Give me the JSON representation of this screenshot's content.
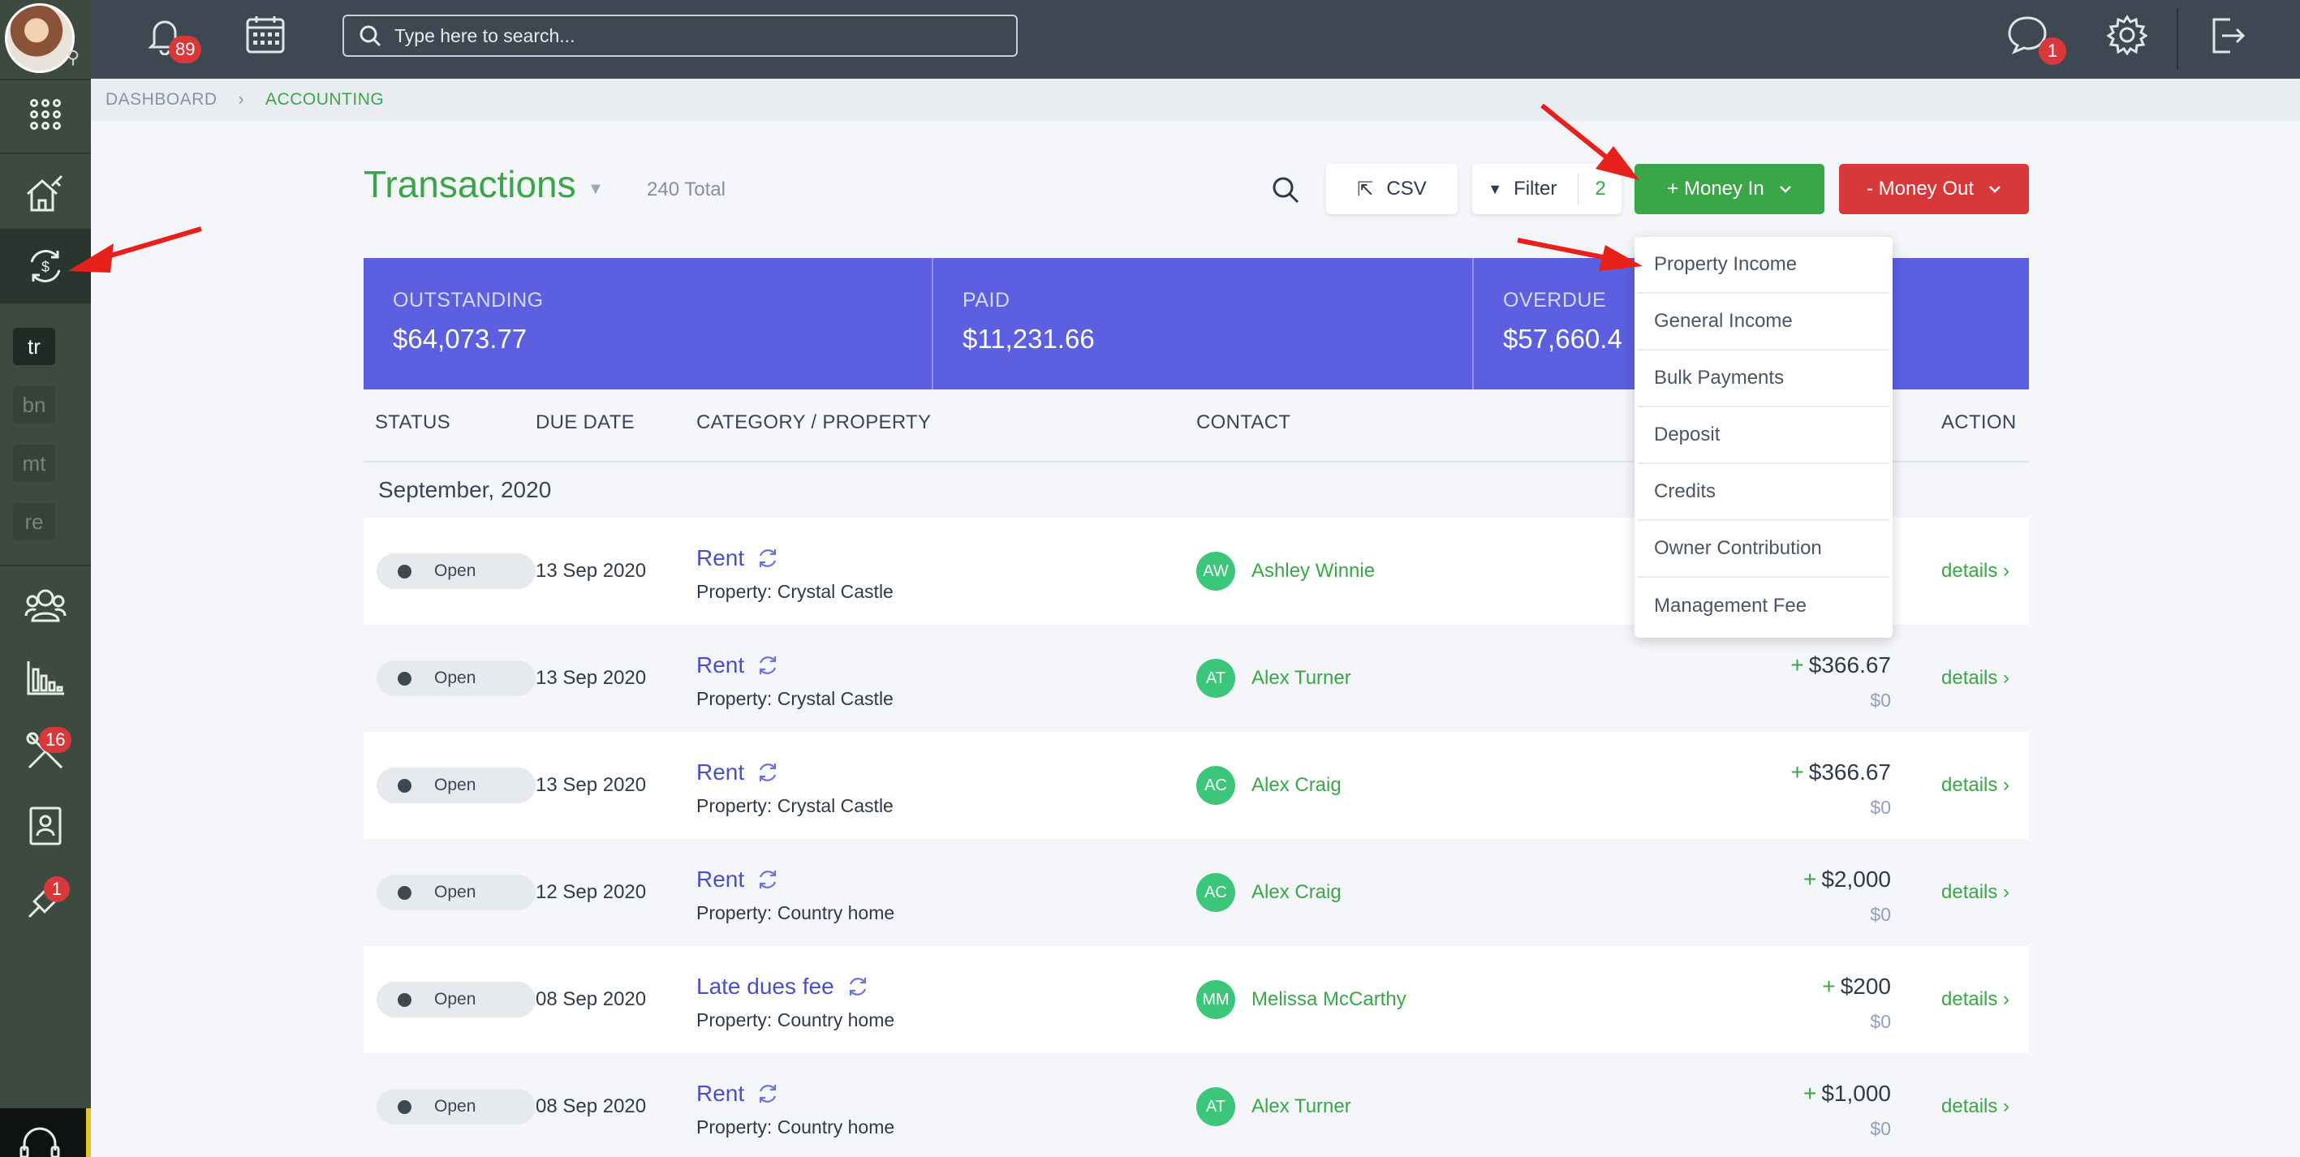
{
  "topbar": {
    "notifications_count": "89",
    "search_placeholder": "Type here to search...",
    "messages_count": "1"
  },
  "sidebar": {
    "chips": [
      "tr",
      "bn",
      "mt",
      "re"
    ],
    "tools_badge": "16",
    "links_badge": "1"
  },
  "breadcrumb": {
    "home": "DASHBOARD",
    "current": "ACCOUNTING"
  },
  "header": {
    "title": "Transactions",
    "total": "240 Total",
    "csv_label": "CSV",
    "filter_label": "Filter",
    "filter_count": "2",
    "money_in_label": "+ Money In",
    "money_out_label": "- Money Out"
  },
  "summary": {
    "outstanding_label": "OUTSTANDING",
    "outstanding_value": "$64,073.77",
    "paid_label": "PAID",
    "paid_value": "$11,231.66",
    "overdue_label": "OVERDUE",
    "overdue_value": "$57,660.4"
  },
  "table": {
    "headers": [
      "STATUS",
      "DUE DATE",
      "CATEGORY / PROPERTY",
      "CONTACT",
      "ACTION"
    ],
    "month": "September, 2020",
    "details_label": "details",
    "rows": [
      {
        "status": "Open",
        "date": "13 Sep 2020",
        "category": "Rent",
        "property": "Property: Crystal Castle",
        "initials": "AW",
        "contact": "Ashley Winnie",
        "amount": "",
        "sub": ""
      },
      {
        "status": "Open",
        "date": "13 Sep 2020",
        "category": "Rent",
        "property": "Property: Crystal Castle",
        "initials": "AT",
        "contact": "Alex Turner",
        "amount": "$366.67",
        "sub": "$0"
      },
      {
        "status": "Open",
        "date": "13 Sep 2020",
        "category": "Rent",
        "property": "Property: Crystal Castle",
        "initials": "AC",
        "contact": "Alex Craig",
        "amount": "$366.67",
        "sub": "$0"
      },
      {
        "status": "Open",
        "date": "12 Sep 2020",
        "category": "Rent",
        "property": "Property: Country home",
        "initials": "AC",
        "contact": "Alex Craig",
        "amount": "$2,000",
        "sub": "$0"
      },
      {
        "status": "Open",
        "date": "08 Sep 2020",
        "category": "Late dues fee",
        "property": "Property: Country home",
        "initials": "MM",
        "contact": "Melissa McCarthy",
        "amount": "$200",
        "sub": "$0"
      },
      {
        "status": "Open",
        "date": "08 Sep 2020",
        "category": "Rent",
        "property": "Property: Country home",
        "initials": "AT",
        "contact": "Alex Turner",
        "amount": "$1,000",
        "sub": "$0"
      }
    ]
  },
  "money_in_menu": [
    "Property Income",
    "General Income",
    "Bulk Payments",
    "Deposit",
    "Credits",
    "Owner Contribution",
    "Management Fee"
  ],
  "colors": {
    "accent_green": "#3aa648",
    "danger_red": "#d9383a",
    "summary_purple": "#5b5fe0",
    "annotation_red": "#e8201c"
  }
}
